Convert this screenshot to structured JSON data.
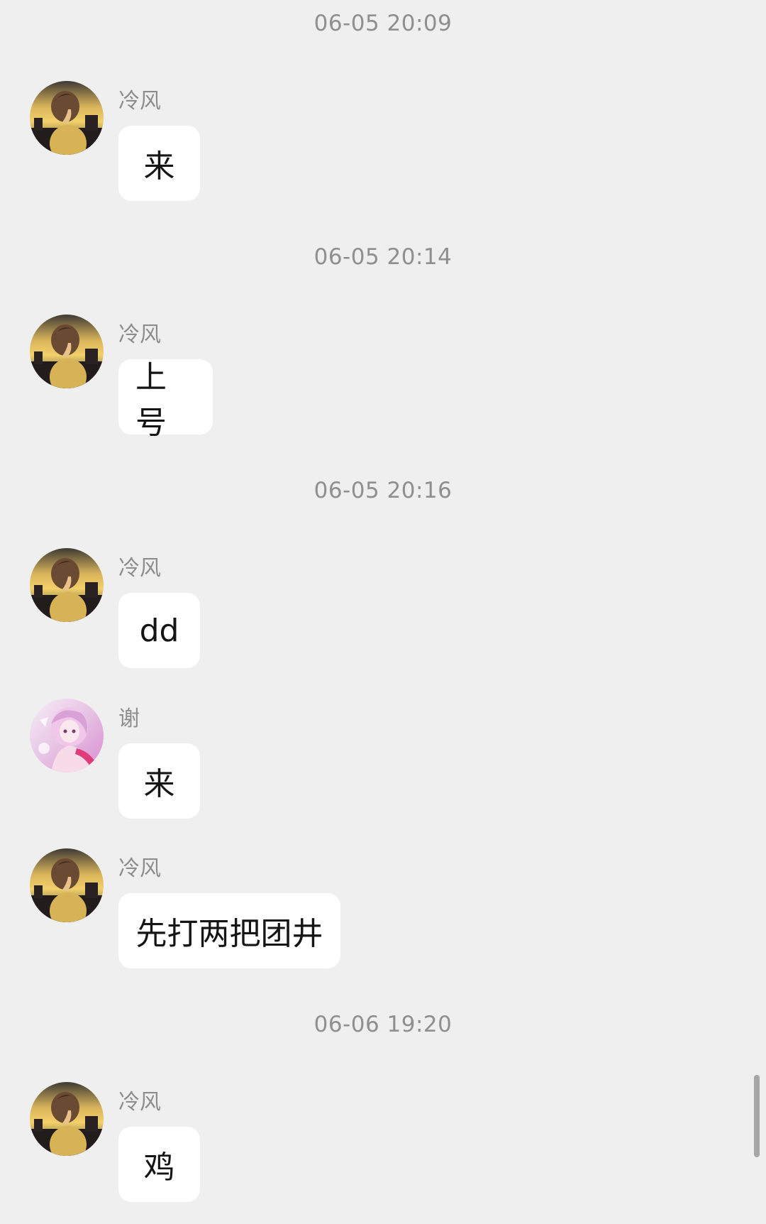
{
  "timestamps": [
    "06-05 20:09",
    "06-05 20:14",
    "06-05 20:16",
    "06-06 19:20"
  ],
  "messages": [
    {
      "sender": "冷风",
      "text": "来",
      "avatar": "sunset-boy-avatar"
    },
    {
      "sender": "冷风",
      "text": "上号",
      "avatar": "sunset-boy-avatar"
    },
    {
      "sender": "冷风",
      "text": "dd",
      "avatar": "sunset-boy-avatar"
    },
    {
      "sender": "谢",
      "text": "来",
      "avatar": "anime-pink-avatar"
    },
    {
      "sender": "冷风",
      "text": "先打两把团井",
      "avatar": "sunset-boy-avatar"
    },
    {
      "sender": "冷风",
      "text": "鸡",
      "avatar": "sunset-boy-avatar"
    }
  ],
  "colors": {
    "background": "#efefef",
    "bubble": "#ffffff",
    "timestamp_text": "#8f8f8f",
    "name_text": "#8d8d8d"
  }
}
